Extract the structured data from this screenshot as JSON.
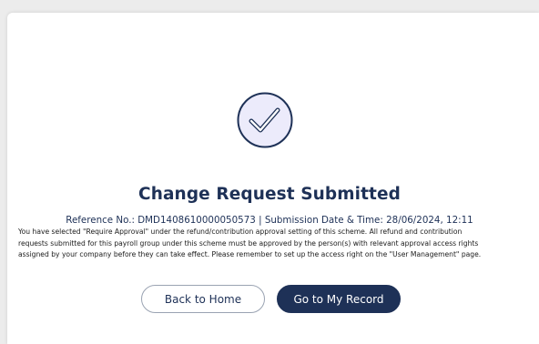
{
  "result": {
    "title": "Change Request Submitted",
    "reference": "Reference No.: DMD1408610000050573 | Submission Date & Time: 28/06/2024, 12:11",
    "notice_lines": [
      "You have selected \"Require Approval\" under the refund/contribution approval setting of this scheme. All refund and contribution",
      "requests submitted for this payroll group under this scheme must be approved by the person(s) with relevant approval access rights",
      "assigned by your company before they can take effect. Please remember to set up the access right on the \"User Management\" page."
    ],
    "icon": "check-circle-icon"
  },
  "actions": {
    "back_label": "Back to Home",
    "record_label": "Go to My Record"
  },
  "colors": {
    "primary": "#1e3157",
    "icon_fill": "#ecebfb",
    "background": "#ececec"
  }
}
